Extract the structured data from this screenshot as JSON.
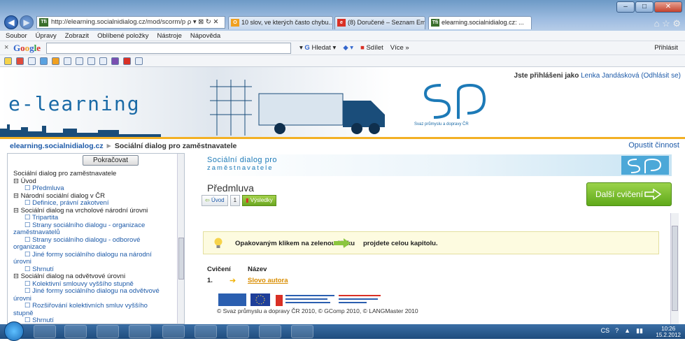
{
  "browser": {
    "address": "http://elearning.socialnidialog.cz/mod/scorm/p",
    "tabs": [
      {
        "label": "10 slov, ve kterých často chybu...",
        "color": "#f0a020",
        "icon": "O"
      },
      {
        "label": "(8) Doručené – Seznam Email",
        "color": "#d93025",
        "icon": "e"
      },
      {
        "label": "elearning.socialnidialog.cz: ...",
        "color": "#3a6e2c",
        "icon": "Tfi"
      }
    ],
    "menu": [
      "Soubor",
      "Úpravy",
      "Zobrazit",
      "Oblíbené položky",
      "Nástroje",
      "Nápověda"
    ],
    "google": {
      "logo": "Google",
      "search_btn": "Hledat",
      "share": "Sdílet",
      "more": "Více »",
      "login": "Přihlásit"
    }
  },
  "header": {
    "logo_text": "e-learning",
    "sp_subtitle": "Svaz průmyslu a dopravy ČR",
    "user_prefix": "Jste přihlášeni jako",
    "user_name": "Lenka Jandásková",
    "logout": "(Odhlásit se)"
  },
  "breadcrumb": {
    "site": "elearning.socialnidialog.cz",
    "sep": "►",
    "current": "Sociální dialog pro zaměstnavatele",
    "exit": "Opustit činnost"
  },
  "left": {
    "continue": "Pokračovat",
    "toc": [
      {
        "text": "Sociální dialog pro zaměstnavatele",
        "level": 0
      },
      {
        "text": "⊟ Úvod",
        "level": 0
      },
      {
        "text": "☐ Předmluva",
        "level": 1
      },
      {
        "text": "⊟ Národní sociální dialog v ČR",
        "level": 0
      },
      {
        "text": "☐ Definice, právní zakotvení",
        "level": 1
      },
      {
        "text": "⊟ Sociální dialog na vrcholové národní úrovni",
        "level": 0
      },
      {
        "text": "☐ Tripartita",
        "level": 1
      },
      {
        "text": "☐ Strany sociálního dialogu - organizace",
        "level": 1
      },
      {
        "text": "zaměstnavatelů",
        "level": 2
      },
      {
        "text": "☐ Strany sociálního dialogu - odborové",
        "level": 1
      },
      {
        "text": "organizace",
        "level": 2
      },
      {
        "text": "☐ Jiné formy sociálního dialogu na národní",
        "level": 1
      },
      {
        "text": "úrovni",
        "level": 2
      },
      {
        "text": "☐ Shrnutí",
        "level": 1
      },
      {
        "text": "⊟ Sociální dialog na odvětvové úrovni",
        "level": 0
      },
      {
        "text": "☐ Kolektivní smlouvy vyššího stupně",
        "level": 1
      },
      {
        "text": "☐ Jiné formy sociálního dialogu na odvětvové",
        "level": 1
      },
      {
        "text": "úrovni",
        "level": 2
      },
      {
        "text": "☐ Rozšiřování kolektivních smluv vyššího",
        "level": 1
      },
      {
        "text": "stupně",
        "level": 2
      },
      {
        "text": "☐ Shrnutí",
        "level": 1
      }
    ]
  },
  "content": {
    "banner_title": "Sociální dialog pro",
    "banner_sub": "zaměstnavatele",
    "page_title": "Předmluva",
    "nav_back": "Úvod",
    "nav_page": "1",
    "nav_results": "Výsledky",
    "next": "Další cvičení",
    "hint_a": "Opakovaným klikem na zelenou šipku",
    "hint_b": "projdete celou kapitolu.",
    "col1": "Cvičení",
    "col2": "Název",
    "row_num": "1.",
    "row_link": "Slovo autora",
    "copyright": "© Svaz průmyslu a dopravy ČR 2010, © GComp 2010, © LANGMaster 2010"
  },
  "taskbar": {
    "lang": "CS",
    "time": "10:26",
    "date": "15.2.2012"
  }
}
